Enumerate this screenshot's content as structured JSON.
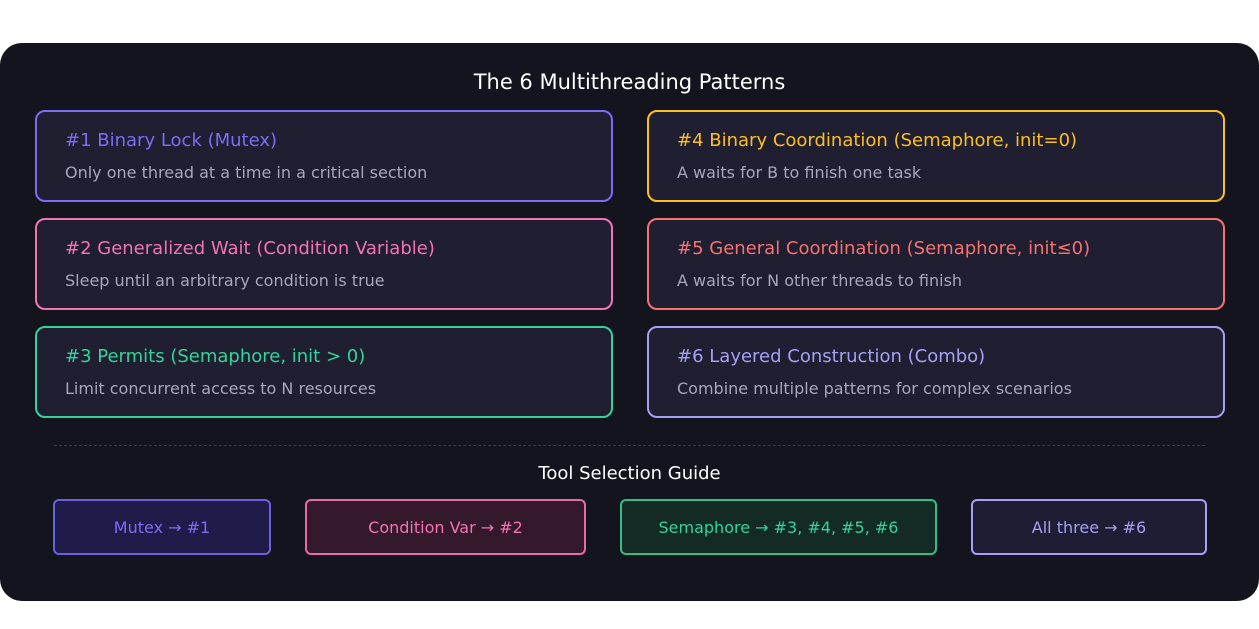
{
  "title": "The 6 Multithreading Patterns",
  "patterns": [
    {
      "title": "#1 Binary Lock (Mutex)",
      "desc": "Only one thread at a time in a critical section",
      "color": "#7b6cf6"
    },
    {
      "title": "#2 Generalized Wait (Condition Variable)",
      "desc": "Sleep until an arbitrary condition is true",
      "color": "#f472b6"
    },
    {
      "title": "#3 Permits (Semaphore, init > 0)",
      "desc": "Limit concurrent access to N resources",
      "color": "#34d399"
    },
    {
      "title": "#4 Binary Coordination (Semaphore, init=0)",
      "desc": "A waits for B to finish one task",
      "color": "#fbbf24"
    },
    {
      "title": "#5 General Coordination (Semaphore, init≤0)",
      "desc": "A waits for N other threads to finish",
      "color": "#f87171"
    },
    {
      "title": "#6 Layered Construction (Combo)",
      "desc": "Combine multiple patterns for complex scenarios",
      "color": "#a5a0f5"
    }
  ],
  "guide": {
    "title": "Tool Selection Guide",
    "tools": [
      {
        "label": "Mutex → #1",
        "color": "#7b6cf6"
      },
      {
        "label": "Condition Var → #2",
        "color": "#f472b6"
      },
      {
        "label": "Semaphore → #3, #4, #5, #6",
        "color": "#34d399"
      },
      {
        "label": "All three → #6",
        "color": "#a5a0f5"
      }
    ]
  }
}
